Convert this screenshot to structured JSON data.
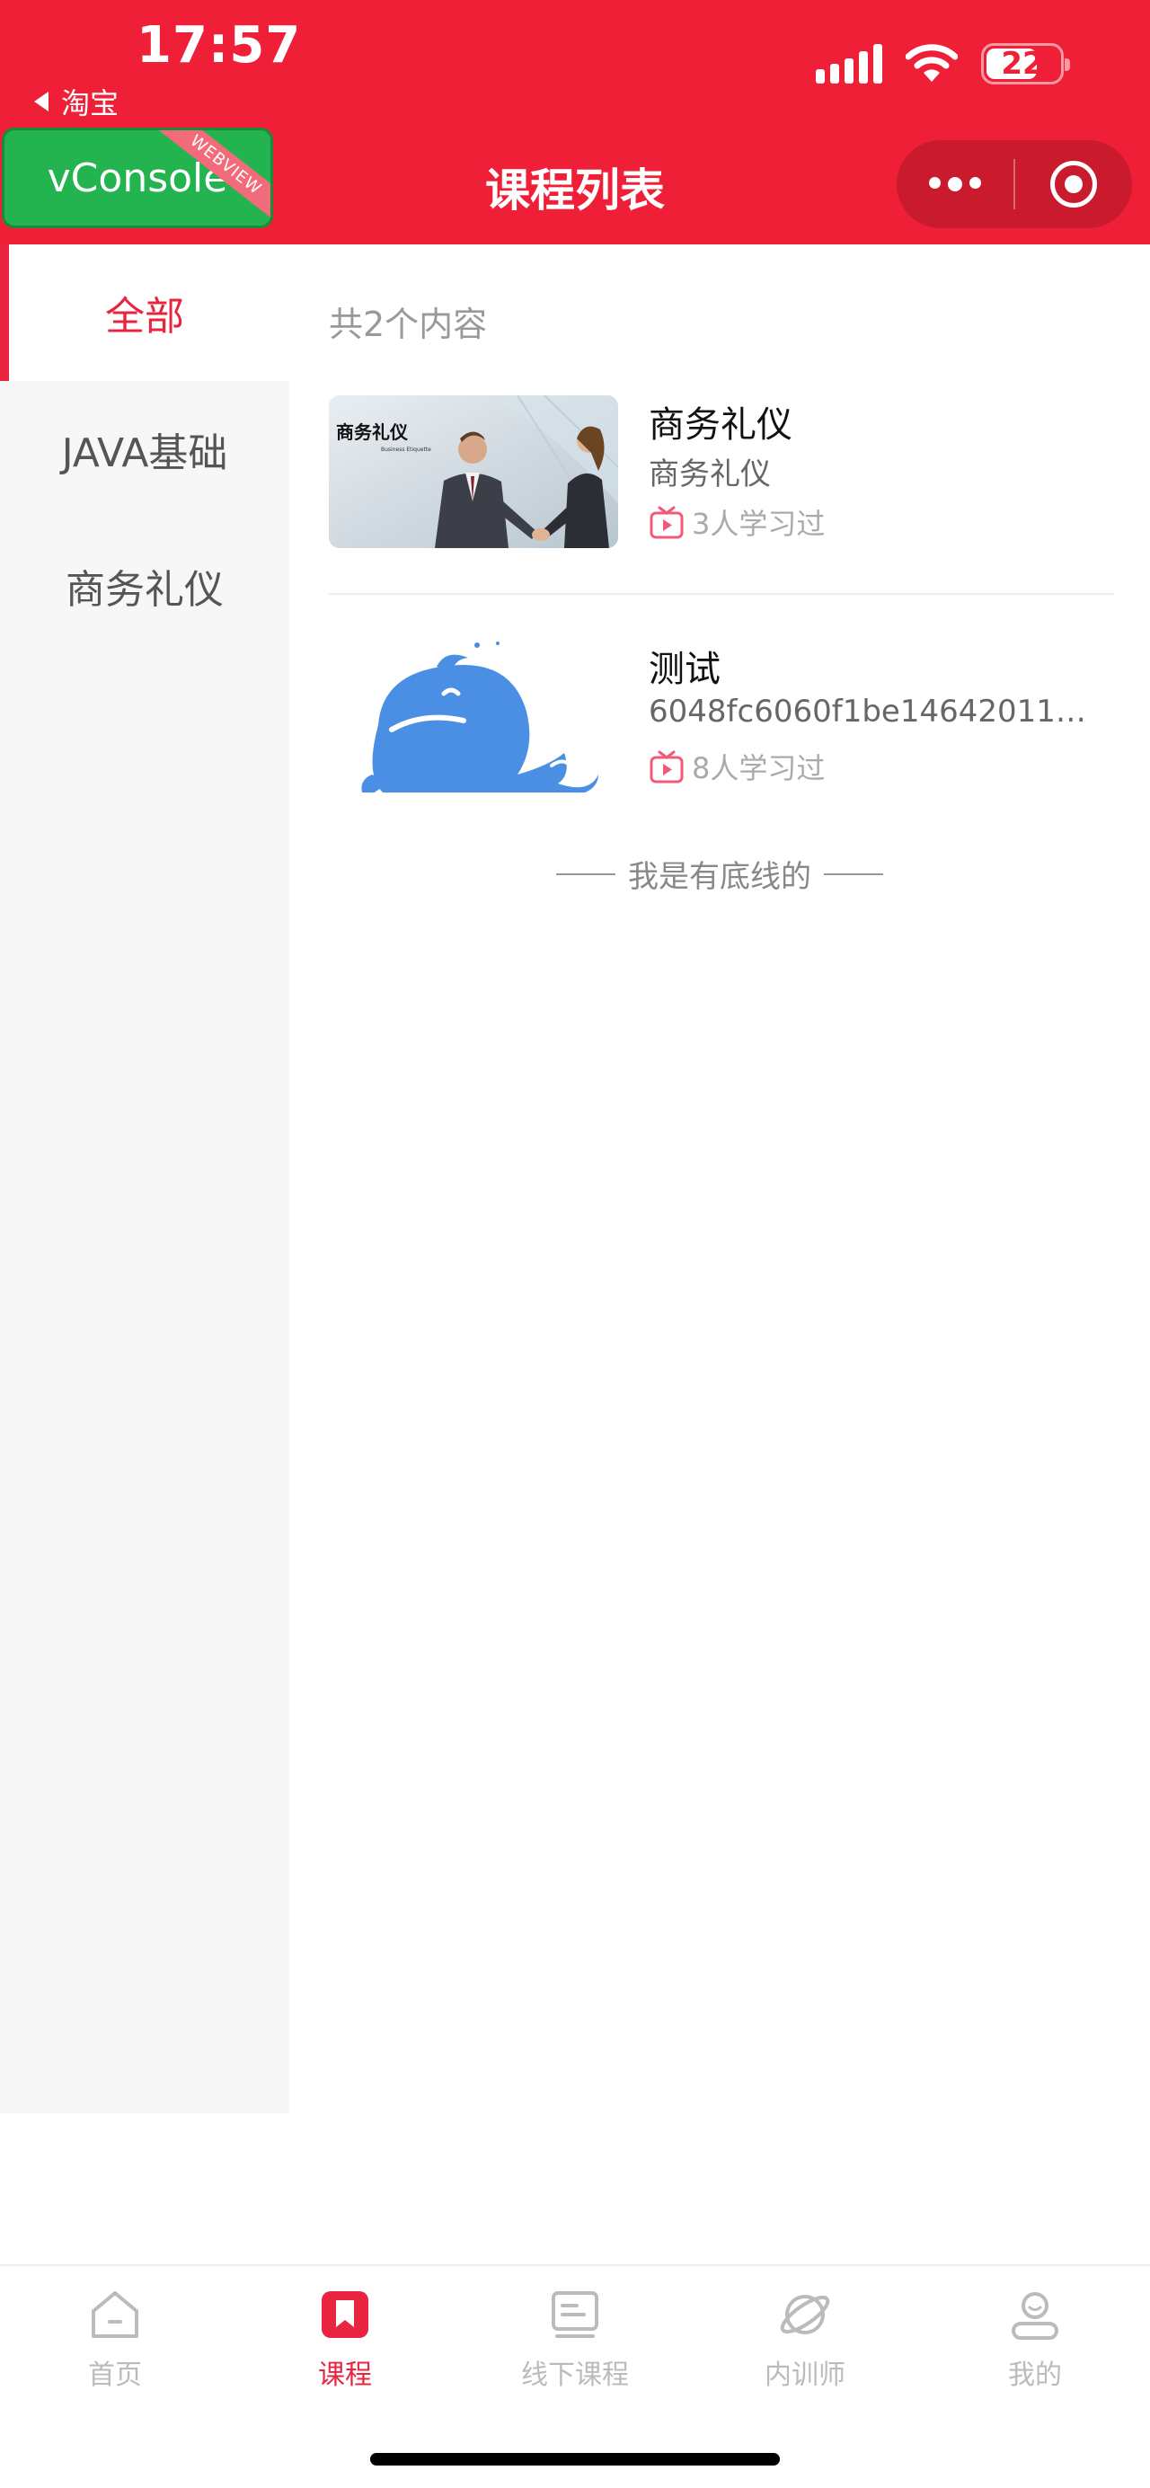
{
  "status_bar": {
    "time": "17:57",
    "back_app": "淘宝",
    "battery": "22"
  },
  "vconsole": {
    "label": "vConsole",
    "ribbon": "WEBVIEW"
  },
  "nav": {
    "title": "课程列表"
  },
  "sidebar": {
    "items": [
      {
        "label": "全部",
        "active": true
      },
      {
        "label": "JAVA基础",
        "active": false
      },
      {
        "label": "商务礼仪",
        "active": false
      }
    ]
  },
  "content": {
    "count_text": "共2个内容",
    "courses": [
      {
        "title": "商务礼仪",
        "subtitle": "商务礼仪",
        "stats": "3人学习过",
        "thumb_caption": "商务礼仪",
        "thumb_caption_en": "Business Etiquette"
      },
      {
        "title": "测试",
        "subtitle": "6048fc6060f1be14642011e068...",
        "stats": "8人学习过"
      }
    ],
    "baseline_text": "我是有底线的"
  },
  "tabbar": {
    "items": [
      {
        "label": "首页",
        "icon": "home-icon",
        "active": false
      },
      {
        "label": "课程",
        "icon": "bookmark-icon",
        "active": true
      },
      {
        "label": "线下课程",
        "icon": "offline-course-icon",
        "active": false
      },
      {
        "label": "内训师",
        "icon": "trainer-icon",
        "active": false
      },
      {
        "label": "我的",
        "icon": "profile-icon",
        "active": false
      }
    ]
  },
  "colors": {
    "brand": "#ee1f37",
    "active": "#e8243f",
    "vconsole": "#23b34f"
  }
}
